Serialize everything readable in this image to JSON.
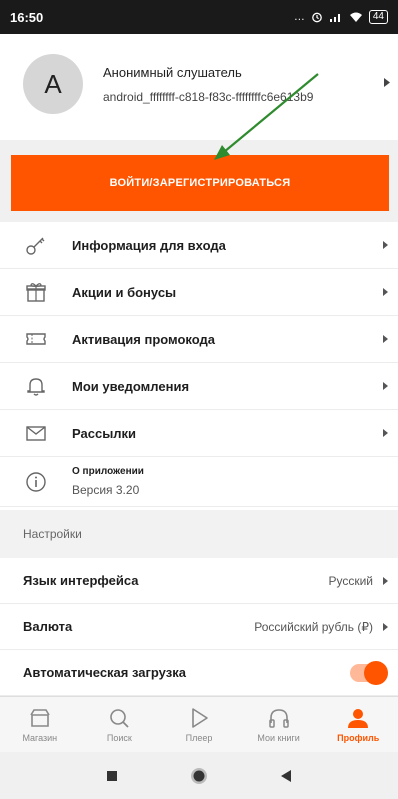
{
  "status_bar": {
    "time": "16:50",
    "battery": "44"
  },
  "profile": {
    "avatar_letter": "A",
    "name": "Анонимный слушатель",
    "device_id": "android_ffffffff-c818-f83c-ffffffffc6e613b9"
  },
  "login": {
    "label": "ВОЙТИ/ЗАРЕГИСТРИРОВАТЬСЯ"
  },
  "menu": {
    "items": [
      {
        "label": "Информация для входа",
        "icon": "key-icon"
      },
      {
        "label": "Акции и бонусы",
        "icon": "gift-icon"
      },
      {
        "label": "Активация промокода",
        "icon": "ticket-icon"
      },
      {
        "label": "Мои уведомления",
        "icon": "bell-icon"
      },
      {
        "label": "Рассылки",
        "icon": "mail-icon"
      }
    ],
    "about": {
      "title": "О приложении",
      "version": "Версия 3.20",
      "icon": "info-icon"
    }
  },
  "settings": {
    "header": "Настройки",
    "language": {
      "label": "Язык интерфейса",
      "value": "Русский"
    },
    "currency": {
      "label": "Валюта",
      "value": "Российский рубль (₽)"
    },
    "autoload": {
      "label": "Автоматическая загрузка",
      "enabled": true
    }
  },
  "tabs": [
    {
      "label": "Магазин",
      "icon": "store-icon",
      "active": false
    },
    {
      "label": "Поиск",
      "icon": "search-icon",
      "active": false
    },
    {
      "label": "Плеер",
      "icon": "play-icon",
      "active": false
    },
    {
      "label": "Мои книги",
      "icon": "headphones-icon",
      "active": false
    },
    {
      "label": "Профиль",
      "icon": "profile-icon",
      "active": true
    }
  ],
  "colors": {
    "accent": "#ff5500",
    "annotation_arrow": "#2e8b2e"
  }
}
